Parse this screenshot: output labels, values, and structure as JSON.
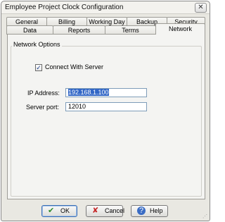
{
  "window": {
    "title": "Employee Project Clock Configuration",
    "close_glyph": "✕"
  },
  "tabs_back": [
    {
      "label": "General"
    },
    {
      "label": "Billing"
    },
    {
      "label": "Working Day"
    },
    {
      "label": "Backup"
    },
    {
      "label": "Security"
    }
  ],
  "tabs_front": [
    {
      "label": "Data"
    },
    {
      "label": "Reports"
    },
    {
      "label": "Terms"
    },
    {
      "label": "Network"
    }
  ],
  "active_tab": "Network",
  "panel": {
    "group_title": "Network Options",
    "connect_checkbox": {
      "label": "Connect With Server",
      "checked": true
    },
    "ip": {
      "label": "IP Address:",
      "value": "192.168.1.100"
    },
    "port": {
      "label": "Server port:",
      "value": "12010"
    }
  },
  "buttons": {
    "ok": "OK",
    "cancel": "Cancel",
    "help": "Help"
  },
  "colors": {
    "selection": "#3166c6",
    "ok_icon": "#2d8a2d",
    "cancel_icon": "#c62828",
    "help_icon": "#3a6cc4"
  }
}
